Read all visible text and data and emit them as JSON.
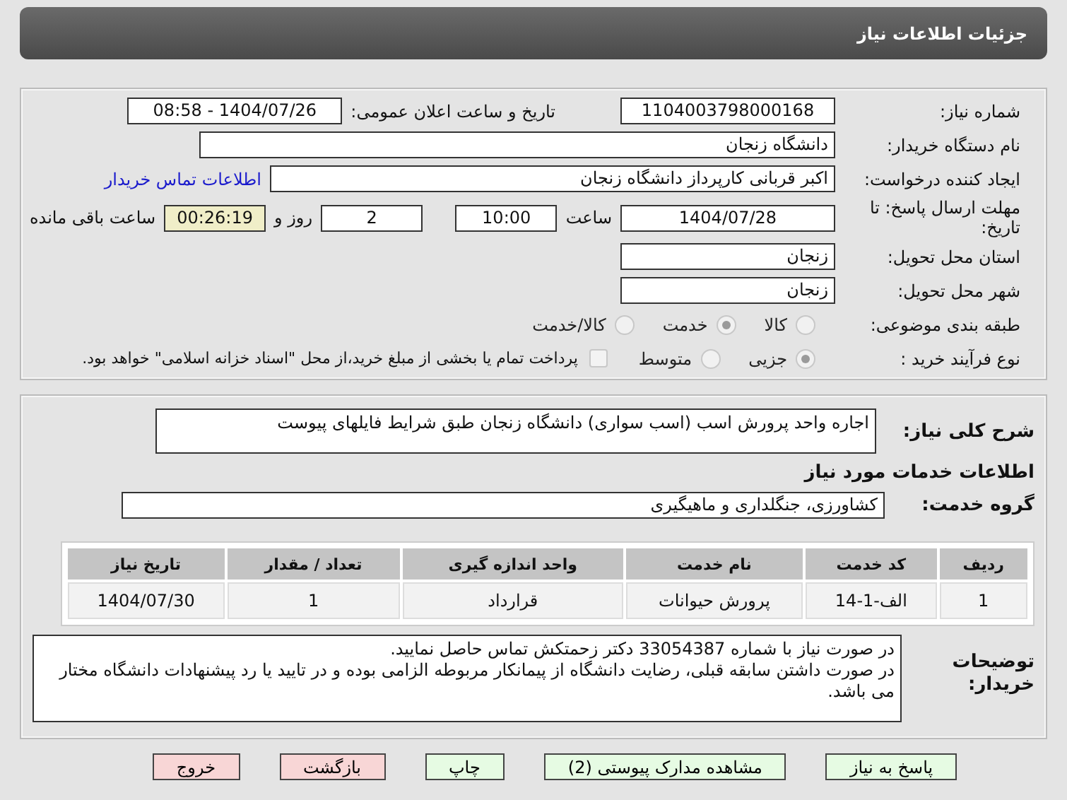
{
  "title": "جزئیات اطلاعات نیاز",
  "need_number": {
    "label": "شماره نیاز:",
    "value": "1104003798000168"
  },
  "announce": {
    "label": "تاریخ و ساعت اعلان عمومی:",
    "value": "1404/07/26 - 08:58"
  },
  "buyer": {
    "label": "نام دستگاه خریدار:",
    "value": "دانشگاه زنجان"
  },
  "creator": {
    "label": "ایجاد کننده درخواست:",
    "value": "اکبر قربانی کارپرداز دانشگاه زنجان",
    "link": "اطلاعات تماس خریدار"
  },
  "deadline": {
    "label": "مهلت ارسال پاسخ: تا تاریخ:",
    "date": "1404/07/28",
    "time_label": "ساعت",
    "time": "10:00",
    "days": "2",
    "days_label": "روز و",
    "remaining": "00:26:19",
    "remaining_label": "ساعت باقی مانده"
  },
  "province": {
    "label": "استان محل تحویل:",
    "value": "زنجان"
  },
  "city": {
    "label": "شهر محل تحویل:",
    "value": "زنجان"
  },
  "category": {
    "label": "طبقه بندی موضوعی:",
    "options": [
      {
        "label": "کالا",
        "selected": false
      },
      {
        "label": "خدمت",
        "selected": true
      },
      {
        "label": "کالا/خدمت",
        "selected": false
      }
    ]
  },
  "process": {
    "label": "نوع فرآیند خرید :",
    "options": [
      {
        "label": "جزیی",
        "selected": true
      },
      {
        "label": "متوسط",
        "selected": false
      }
    ],
    "payment": {
      "checked": false,
      "text": "پرداخت تمام یا بخشی از مبلغ خرید،از محل \"اسناد خزانه اسلامی\" خواهد بود."
    }
  },
  "description": {
    "label": "شرح کلی نیاز:",
    "value": "اجاره واحد پرورش اسب (اسب سواری) دانشگاه زنجان طبق شرایط فایلهای پیوست"
  },
  "services_heading": "اطلاعات خدمات مورد نیاز",
  "service_group": {
    "label": "گروه خدمت:",
    "value": "کشاورزی، جنگلداری و ماهیگیری"
  },
  "table": {
    "columns": [
      "ردیف",
      "کد خدمت",
      "نام خدمت",
      "واحد اندازه گیری",
      "تعداد / مقدار",
      "تاریخ نیاز"
    ],
    "rows": [
      [
        "1",
        "الف-1-14",
        "پرورش حیوانات",
        "قرارداد",
        "1",
        "1404/07/30"
      ]
    ]
  },
  "notes": {
    "label": "توضیحات خریدار:",
    "lines": [
      "در صورت نیاز با شماره 33054387 دکتر زحمتکش تماس حاصل نمایید.",
      "در صورت داشتن سابقه قبلی، رضایت دانشگاه از پیمانکار مربوطه الزامی بوده و در تایید یا رد پیشنهادات دانشگاه مختار می باشد."
    ]
  },
  "buttons": [
    {
      "label": "پاسخ به نیاز",
      "kind": "primary"
    },
    {
      "label": "مشاهده مدارک پیوستی (2)",
      "kind": "primary"
    },
    {
      "label": "چاپ",
      "kind": "primary"
    },
    {
      "label": "بازگشت",
      "kind": "danger"
    },
    {
      "label": "خروج",
      "kind": "danger"
    }
  ]
}
